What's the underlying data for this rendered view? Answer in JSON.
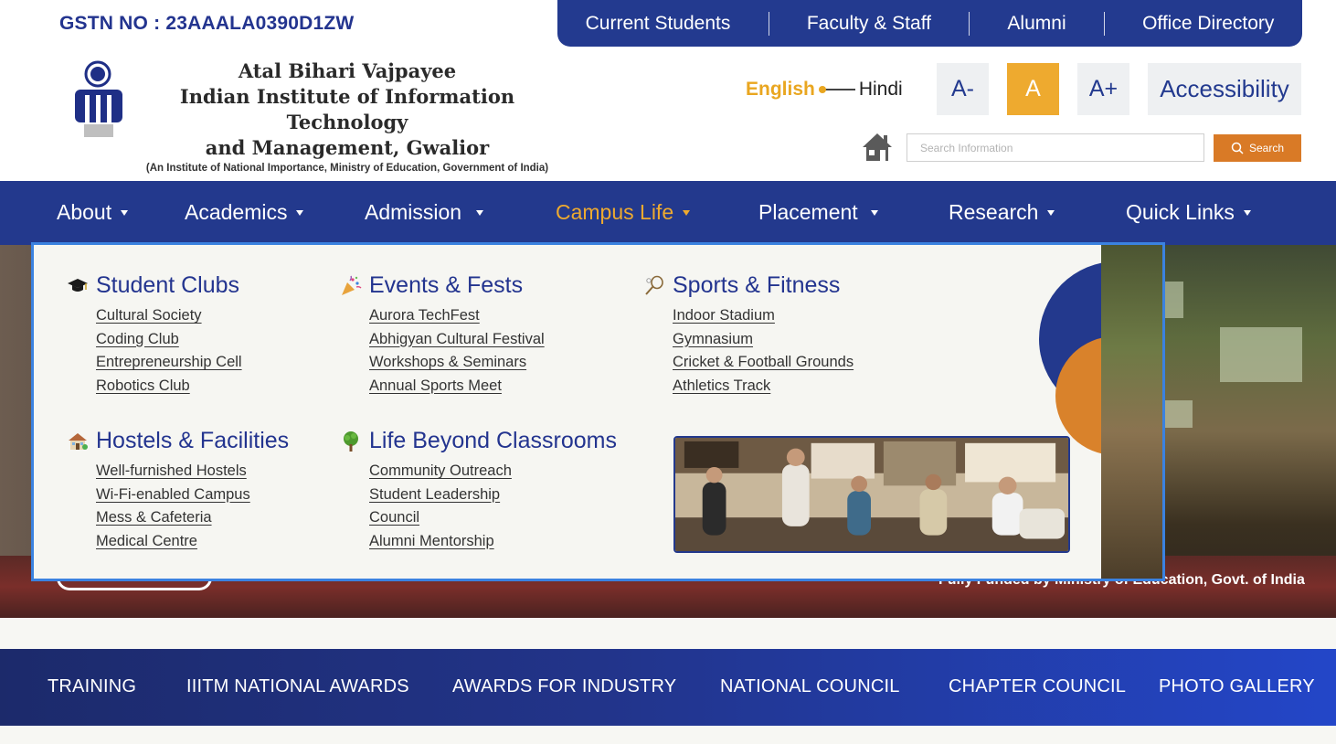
{
  "header": {
    "gstn": "GSTN NO : 23AAALA0390D1ZW",
    "institute": {
      "line1": "Atal Bihari Vajpayee",
      "line2": "Indian Institute of Information Technology",
      "line3": "and Management, Gwalior",
      "line4": "(An Institute of National Importance, Ministry of Education, Government of India)"
    }
  },
  "topbar": {
    "links": [
      "Current Students",
      "Faculty & Staff",
      "Alumni",
      "Office Directory"
    ]
  },
  "language": {
    "english": "English",
    "hindi": "Hindi",
    "selected": "English"
  },
  "font_size": {
    "decrease": "A-",
    "normal": "A",
    "increase": "A+",
    "active": "A"
  },
  "accessibility": {
    "label": "Accessibility"
  },
  "search": {
    "placeholder": "Search Information",
    "button_label": "Search"
  },
  "nav": {
    "items": [
      {
        "label": "About"
      },
      {
        "label": "Academics"
      },
      {
        "label": "Admission"
      },
      {
        "label": "Campus Life",
        "active": true
      },
      {
        "label": "Placement"
      },
      {
        "label": "Research"
      },
      {
        "label": "Quick Links"
      }
    ]
  },
  "mega_menu": {
    "columns": [
      {
        "icon": "graduation-cap-icon",
        "title": "Student Clubs",
        "links": [
          "Cultural Society",
          "Coding Club",
          "Entrepreneurship Cell",
          "Robotics Club"
        ]
      },
      {
        "icon": "party-popper-icon",
        "title": "Events & Fests",
        "links": [
          "Aurora TechFest",
          "Abhigyan Cultural Festival",
          "Workshops & Seminars",
          "Annual Sports Meet"
        ]
      },
      {
        "icon": "badminton-icon",
        "title": "Sports & Fitness",
        "links": [
          "Indoor Stadium",
          "Gymnasium",
          "Cricket & Football Grounds",
          "Athletics Track"
        ]
      },
      {
        "icon": "hostel-house-icon",
        "title": "Hostels & Facilities",
        "links": [
          "Well-furnished Hostels",
          "Wi-Fi-enabled Campus",
          "Mess & Cafeteria",
          "Medical Centre"
        ]
      },
      {
        "icon": "tree-icon",
        "title": "Life Beyond Classrooms",
        "links": [
          "Community Outreach",
          "Student Leadership",
          "Council",
          "Alumni Mentorship"
        ]
      }
    ]
  },
  "hero": {
    "caption": "Fully Funded by Ministry of Education, Govt. of India"
  },
  "quick_bar": {
    "items": [
      "TRAINING",
      "IIITM NATIONAL AWARDS",
      "AWARDS FOR INDUSTRY",
      "NATIONAL COUNCIL",
      "CHAPTER COUNCIL",
      "PHOTO GALLERY"
    ]
  },
  "colors": {
    "primary_blue": "#233a8f",
    "accent_gold": "#eeaa2f",
    "search_orange": "#d97a26",
    "highlight_border": "#3b82e0"
  }
}
